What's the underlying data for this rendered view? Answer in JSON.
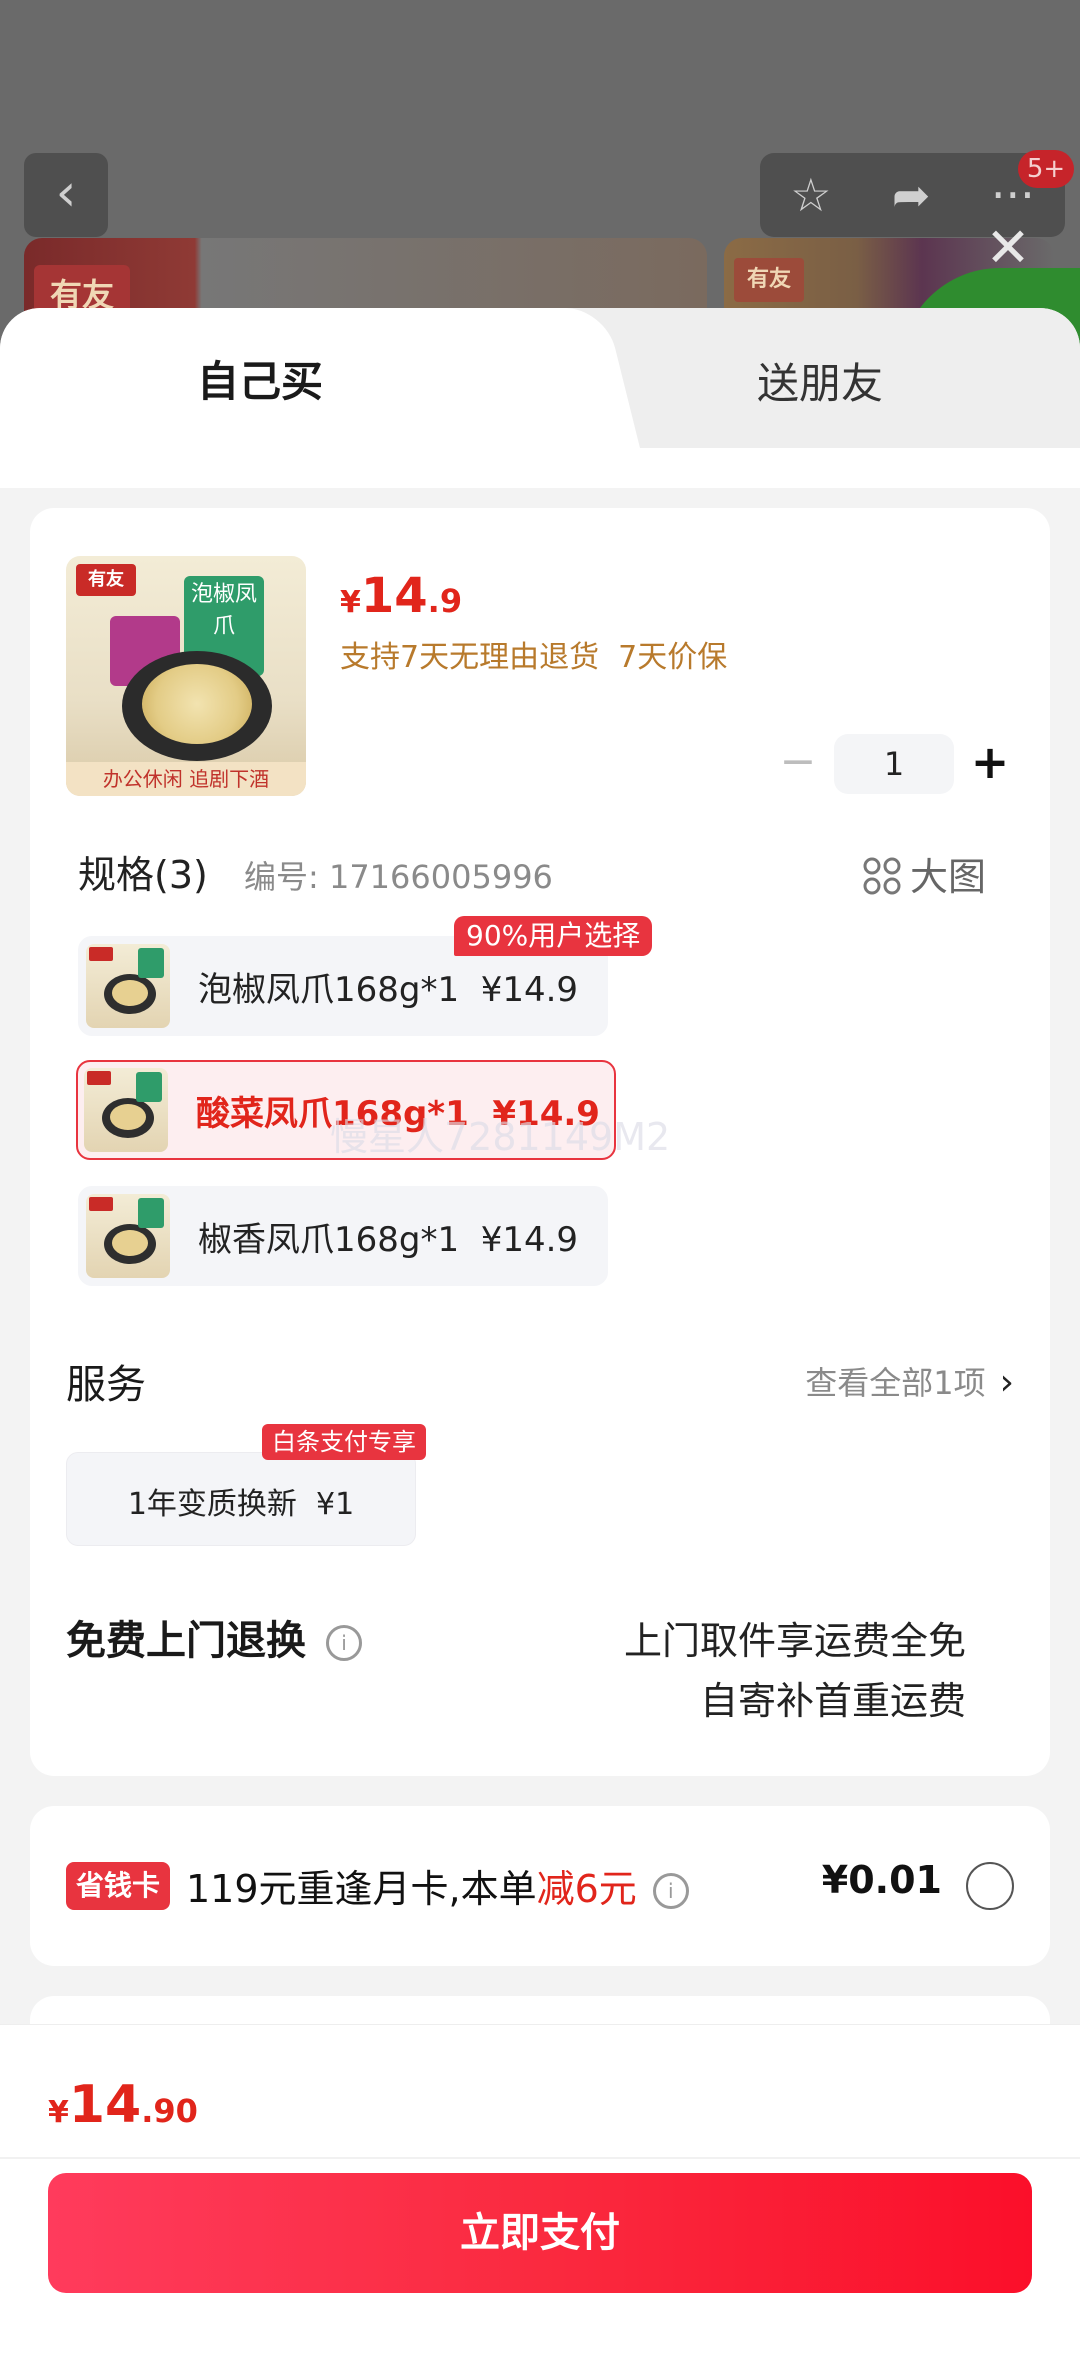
{
  "background": {
    "notification_badge": "5+",
    "brand_logo": "有友"
  },
  "tabs": [
    {
      "label": "自己买",
      "active": true
    },
    {
      "label": "送朋友",
      "active": false
    }
  ],
  "product": {
    "price_currency": "¥",
    "price_int": "14",
    "price_dec": ".9",
    "promise": "支持7天无理由退货  7天价保",
    "image_logo": "有友",
    "image_pack_text": "泡椒凤爪",
    "image_caption": "办公休闲  追剧下酒",
    "quantity": "1"
  },
  "spec": {
    "title": "规格(3)",
    "code": "编号: 17166005996",
    "big_image_label": "大图",
    "options": [
      {
        "label": "泡椒凤爪168g*1  ¥14.9",
        "tag": "90%用户选择",
        "selected": false
      },
      {
        "label": "酸菜凤爪168g*1  ¥14.9",
        "selected": true
      },
      {
        "label": "椒香凤爪168g*1  ¥14.9",
        "selected": false
      }
    ],
    "watermark": "慢星人7281149M2"
  },
  "service": {
    "title": "服务",
    "view_all": "查看全部1项",
    "item_label": "1年变质换新  ¥1",
    "item_tag": "白条支付专享"
  },
  "free_return": {
    "title": "免费上门退换",
    "line1": "上门取件享运费全免",
    "line2": "自寄补首重运费"
  },
  "vip": {
    "badge": "省钱卡",
    "text_prefix": "119元重逢月卡,本单",
    "text_highlight": "减6元",
    "price": "¥0.01"
  },
  "footer": {
    "total_currency": "¥",
    "total_int": "14",
    "total_dec": ".90",
    "pay_label": "立即支付"
  },
  "colors": {
    "accent_red": "#e1251b",
    "tag_red": "#e8343f",
    "promise_gold": "#b87a2c"
  }
}
